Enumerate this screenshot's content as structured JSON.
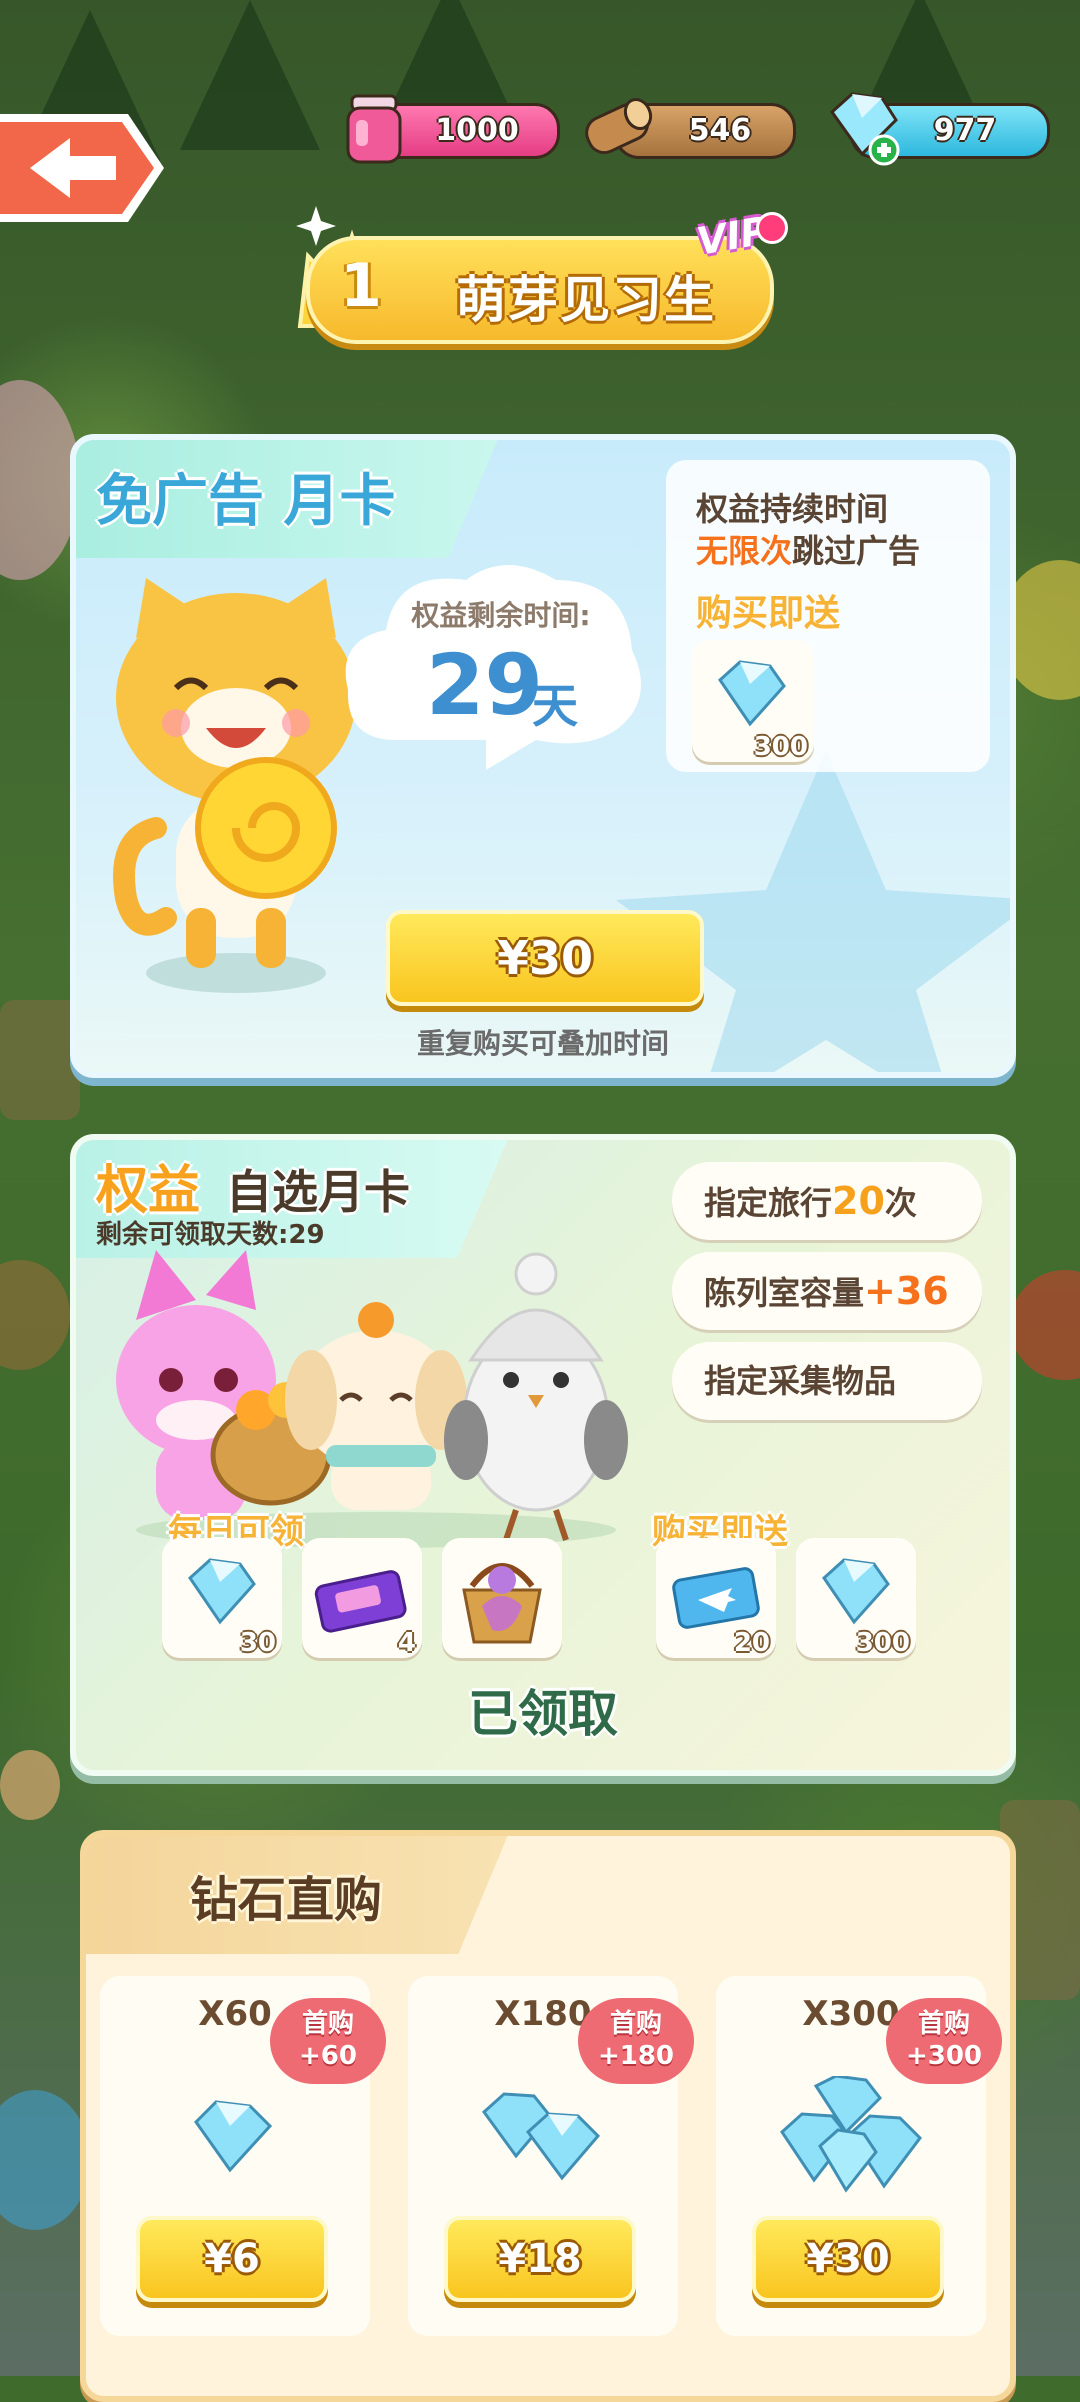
{
  "resources": [
    {
      "name": "jam",
      "value": "1000",
      "color": "#ee4a8a"
    },
    {
      "name": "wood",
      "value": "546",
      "color": "#b48248"
    },
    {
      "name": "diamond",
      "value": "977",
      "color": "#3cc6e6"
    }
  ],
  "vip": {
    "level": "1",
    "title": "萌芽见习生",
    "tag": "VIP"
  },
  "ad_card": {
    "title": "免广告 月卡",
    "remaining_label": "权益剩余时间:",
    "remaining_days": "29",
    "days_unit": "天",
    "benefit_line1": "权益持续时间",
    "benefit_highlight": "无限次",
    "benefit_line2": "跳过广告",
    "buy_gift_label": "购买即送",
    "gift_qty": "300",
    "price": "¥30",
    "note": "重复购买可叠加时间"
  },
  "choice_card": {
    "title_highlight": "权益",
    "title": "自选月卡",
    "remaining": "剩余可领取天数:29",
    "perks": [
      {
        "prefix": "指定旅行",
        "value": "20",
        "suffix": "次"
      },
      {
        "prefix": "陈列室容量",
        "value": "+36",
        "suffix": ""
      },
      {
        "prefix": "指定采集物品",
        "value": "",
        "suffix": ""
      }
    ],
    "daily_label": "每日可领",
    "daily_items": [
      {
        "icon": "diamond-icon",
        "qty": "30"
      },
      {
        "icon": "ticket-icon",
        "qty": "4"
      },
      {
        "icon": "basket-icon",
        "qty": ""
      }
    ],
    "buy_label": "购买即送",
    "buy_items": [
      {
        "icon": "travel-ticket-icon",
        "qty": "20"
      },
      {
        "icon": "diamond-icon",
        "qty": "300"
      }
    ],
    "claimed": "已领取"
  },
  "diamond_shop": {
    "title": "钻石直购",
    "items": [
      {
        "qty": "X60",
        "first_label": "首购",
        "first_bonus": "+60",
        "price": "¥6"
      },
      {
        "qty": "X180",
        "first_label": "首购",
        "first_bonus": "+180",
        "price": "¥18"
      },
      {
        "qty": "X300",
        "first_label": "首购",
        "first_bonus": "+300",
        "price": "¥30"
      }
    ]
  }
}
